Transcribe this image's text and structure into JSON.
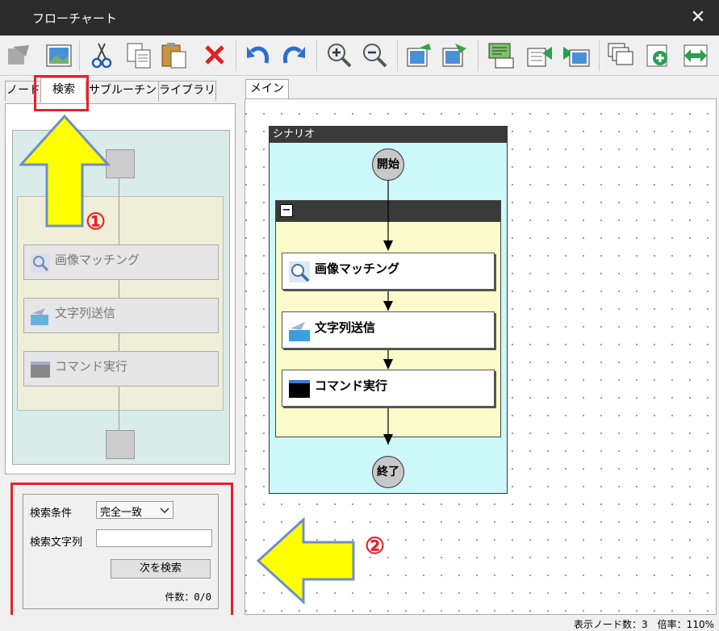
{
  "window": {
    "title": "フローチャート",
    "close_symbol": "✕"
  },
  "toolbar": {
    "icons": [
      "node-icon",
      "image-icon",
      "cut-icon",
      "copy-icon",
      "paste-icon",
      "delete-icon",
      "undo-icon",
      "redo-icon",
      "zoom-in-icon",
      "zoom-out-icon",
      "import-icon",
      "export-icon",
      "screen-capture-icon",
      "move-left-icon",
      "move-right-icon",
      "layer-icon",
      "add-node-icon",
      "swap-icon"
    ]
  },
  "left_tabs": [
    "ノード",
    "検索",
    "サブルーチン",
    "ライブラリ"
  ],
  "right_tabs": [
    "メイン"
  ],
  "preview": {
    "nodes": [
      "画像マッチング",
      "文字列送信",
      "コマンド実行"
    ]
  },
  "search": {
    "condition_label": "検索条件",
    "condition_value": "完全一致",
    "text_label": "検索文字列",
    "text_value": "",
    "next_button": "次を検索",
    "count": "件数：0/0"
  },
  "flowchart": {
    "scenario_label": "シナリオ",
    "start_label": "開始",
    "end_label": "終了",
    "group_toggle": "−",
    "nodes": [
      "画像マッチング",
      "文字列送信",
      "コマンド実行"
    ]
  },
  "annotations": {
    "marker1": "①",
    "marker2": "②"
  },
  "status": {
    "text": "表示ノード数：3　倍率：110%"
  },
  "colors": {
    "scenario_bg": "#ccf8fa",
    "group_bg": "#fbfbcb",
    "arrow_fill": "#ffff00",
    "arrow_outline": "#6d8fc7",
    "highlight": "#e8202a"
  }
}
